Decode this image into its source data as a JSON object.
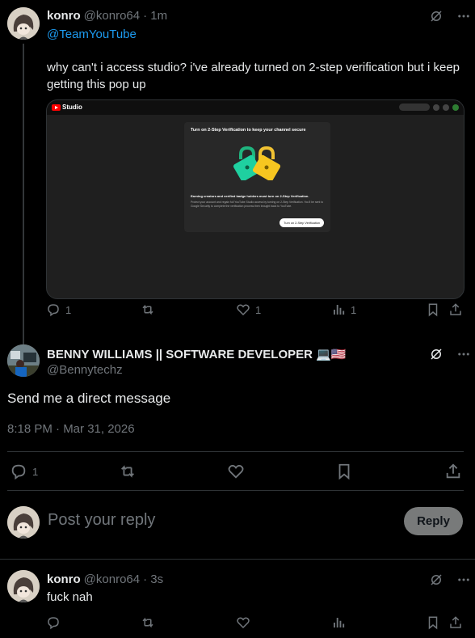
{
  "post1": {
    "name": "konro",
    "handle": "@konro64",
    "time": "· 1m",
    "mention": "@TeamYouTube",
    "text": "why can't i access studio? i've already turned on 2-step verification but i keep getting this pop up",
    "media": {
      "logo_text": "Studio",
      "dialog_title": "Turn on 2-Step Verification to keep your channel secure",
      "dialog_subtitle": "Earning creators and verified badge holders must turn on 2-Step Verification.",
      "dialog_body": "Protect your account and regain full YouTube Studio access by turning on 2-Step Verification. You'll be sent to Google Security to complete the verification process then brought back to YouTube.",
      "dialog_button": "Turn on 2-Step Verification"
    },
    "actions": {
      "replies": "1",
      "reposts": "",
      "likes": "1",
      "views": "1"
    }
  },
  "post2": {
    "name": "BENNY WILLIAMS || SOFTWARE DEVELOPER 💻🇺🇸",
    "handle": "@Bennytechz",
    "text": "Send me a direct message",
    "timestamp": "8:18 PM · Mar 31, 2026",
    "actions": {
      "replies": "1"
    }
  },
  "reply_box": {
    "placeholder": "Post your reply",
    "button": "Reply"
  },
  "post3": {
    "name": "konro",
    "handle": "@konro64",
    "time": "· 3s",
    "text": "fuck nah"
  },
  "colors": {
    "background": "#000000",
    "text": "#e7e9ea",
    "muted": "#71767b",
    "link": "#1d9bf0",
    "divider": "#2f3336"
  },
  "icons": [
    "grok-icon",
    "more-icon",
    "reply-icon",
    "repost-icon",
    "like-icon",
    "views-icon",
    "bookmark-icon",
    "share-icon"
  ]
}
